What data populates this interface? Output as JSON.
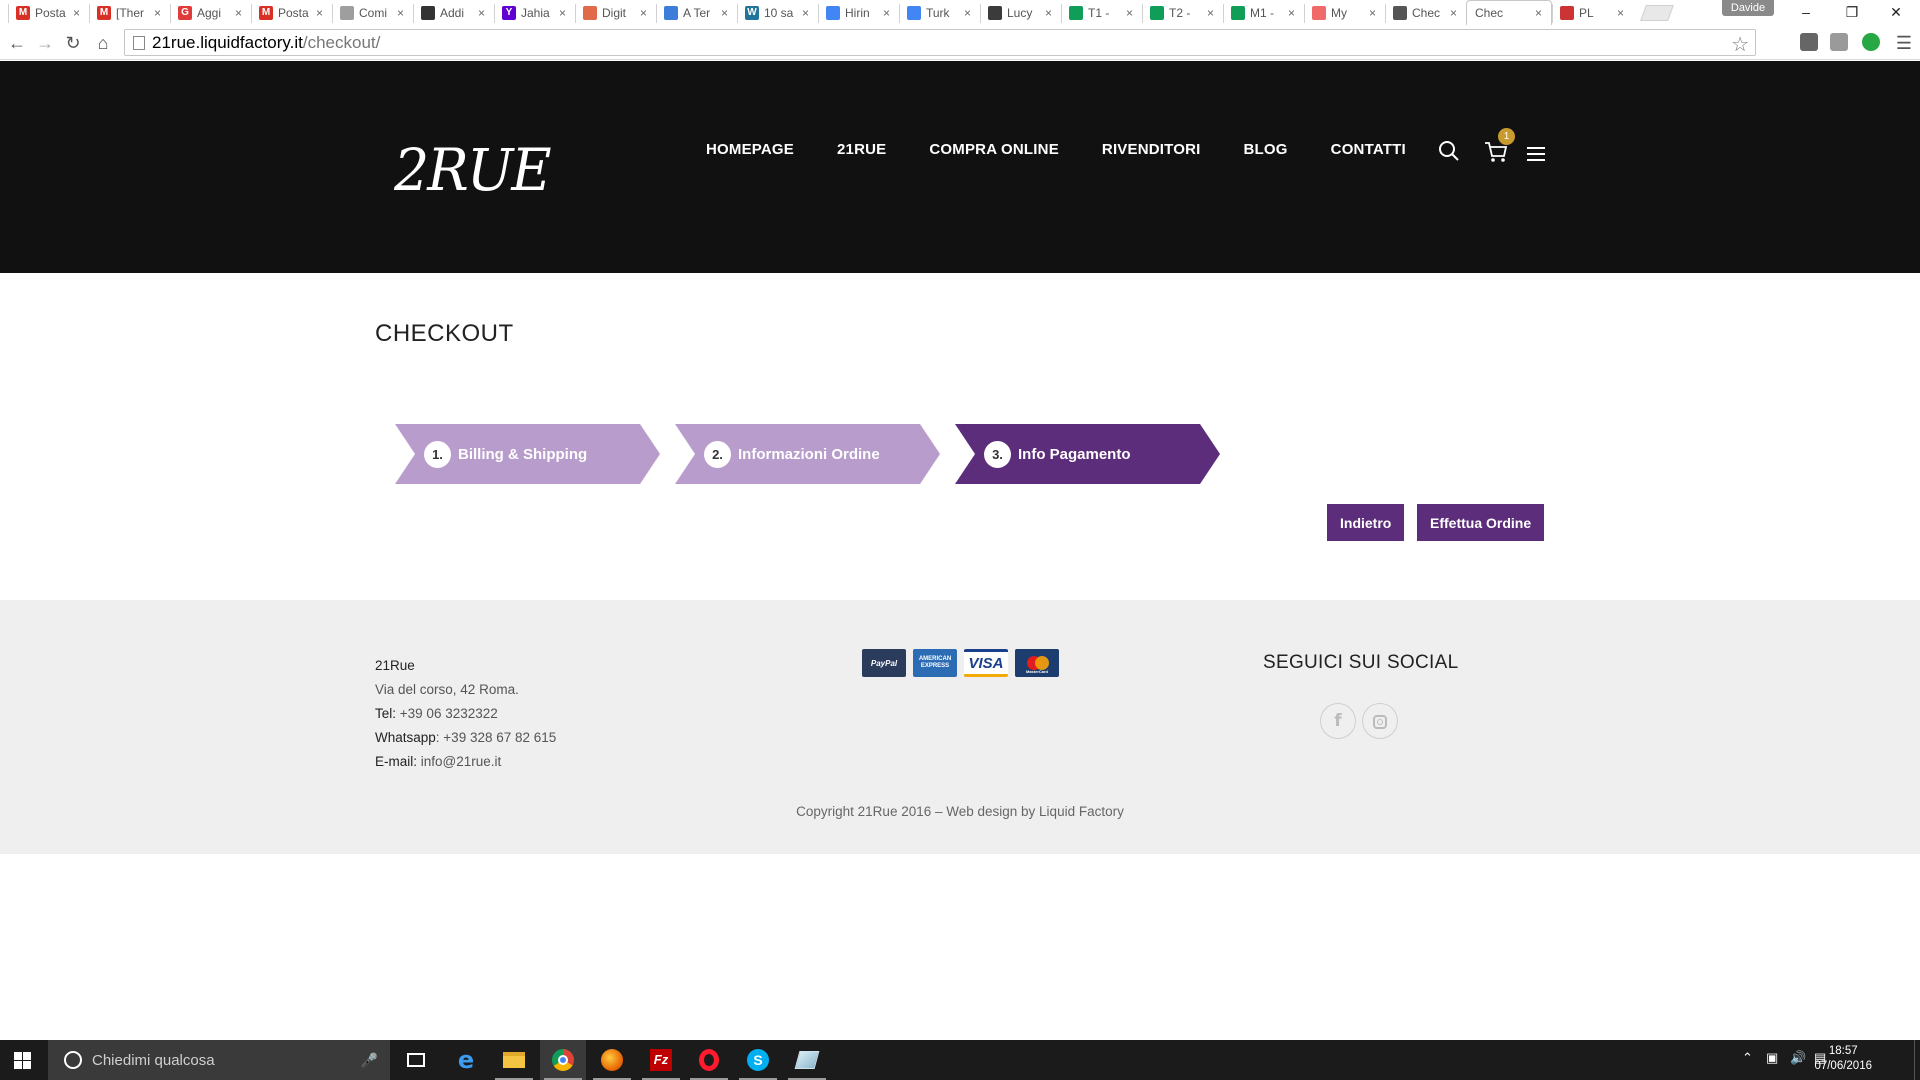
{
  "browser": {
    "tabs": [
      {
        "label": "Posta",
        "favicon": "gmail-icon",
        "color": "#d93025",
        "glyph": "M"
      },
      {
        "label": "[Ther",
        "favicon": "gmail-icon",
        "color": "#d93025",
        "glyph": "M"
      },
      {
        "label": "Aggi",
        "favicon": "red-square-icon",
        "color": "#e03a3a",
        "glyph": "G"
      },
      {
        "label": "Posta",
        "favicon": "gmail-icon",
        "color": "#d93025",
        "glyph": "M"
      },
      {
        "label": "Comi",
        "favicon": "page-icon",
        "color": "#9e9e9e",
        "glyph": ""
      },
      {
        "label": "Addi",
        "favicon": "github-icon",
        "color": "#333333",
        "glyph": ""
      },
      {
        "label": "Jahia",
        "favicon": "yahoo-icon",
        "color": "#6001d2",
        "glyph": "Y"
      },
      {
        "label": "Digit",
        "favicon": "colorful-icon",
        "color": "#e06a4a",
        "glyph": ""
      },
      {
        "label": "A Ter",
        "favicon": "square-outline-icon",
        "color": "#3b7dd8",
        "glyph": ""
      },
      {
        "label": "10 sa",
        "favicon": "wordpress-icon",
        "color": "#21759b",
        "glyph": "W"
      },
      {
        "label": "Hirin",
        "favicon": "docs-icon",
        "color": "#4285f4",
        "glyph": ""
      },
      {
        "label": "Turk",
        "favicon": "docs-icon",
        "color": "#4285f4",
        "glyph": ""
      },
      {
        "label": "Lucy",
        "favicon": "app-icon",
        "color": "#3b3b3b",
        "glyph": ""
      },
      {
        "label": "T1 -",
        "favicon": "sheets-icon",
        "color": "#0f9d58",
        "glyph": ""
      },
      {
        "label": "T2 -",
        "favicon": "sheets-icon",
        "color": "#0f9d58",
        "glyph": ""
      },
      {
        "label": "M1 -",
        "favicon": "sheets-icon",
        "color": "#0f9d58",
        "glyph": ""
      },
      {
        "label": "My",
        "favicon": "dots-icon",
        "color": "#f06a6a",
        "glyph": ""
      },
      {
        "label": "Chec",
        "favicon": "check-icon",
        "color": "#555555",
        "glyph": ""
      },
      {
        "label": "Chec",
        "favicon": "none",
        "color": "#ffffff",
        "glyph": ""
      },
      {
        "label": "PL",
        "favicon": "pokemon-icon",
        "color": "#cc3333",
        "glyph": ""
      }
    ],
    "active_tab": 18,
    "profile_name": "Davide",
    "url_host": "21rue.liquidfactory.it",
    "url_path": "/checkout/"
  },
  "site": {
    "logo": "2RUE",
    "nav": [
      "HOMEPAGE",
      "21RUE",
      "COMPRA ONLINE",
      "RIVENDITORI",
      "BLOG",
      "CONTATTI"
    ],
    "cart_count": "1",
    "accent": "#5c2d7a",
    "step_light": "#b89ccb"
  },
  "checkout": {
    "title": "CHECKOUT",
    "steps": [
      {
        "num": "1.",
        "label": "Billing & Shipping",
        "active": false
      },
      {
        "num": "2.",
        "label": "Informazioni Ordine",
        "active": false
      },
      {
        "num": "3.",
        "label": "Info Pagamento",
        "active": true
      }
    ],
    "back_label": "Indietro",
    "submit_label": "Effettua Ordine"
  },
  "footer": {
    "company": "21Rue",
    "address": "Via del corso, 42 Roma.",
    "tel_label": "Tel:",
    "tel": "+39 06 3232322",
    "whatsapp_label": "Whatsapp",
    "whatsapp": ": +39 328 67 82 615",
    "email_label": "E-mail:",
    "email": "info@21rue.it",
    "payment_cards": [
      "PayPal",
      "AMERICAN EXPRESS",
      "VISA",
      "MasterCard"
    ],
    "social_title": "SEGUICI SUI SOCIAL",
    "social_icons": [
      "facebook-icon",
      "instagram-icon"
    ],
    "copyright": "Copyright 21Rue 2016 – Web design by Liquid Factory"
  },
  "taskbar": {
    "search_placeholder": "Chiedimi qualcosa",
    "time": "18:57",
    "date": "07/06/2016"
  }
}
